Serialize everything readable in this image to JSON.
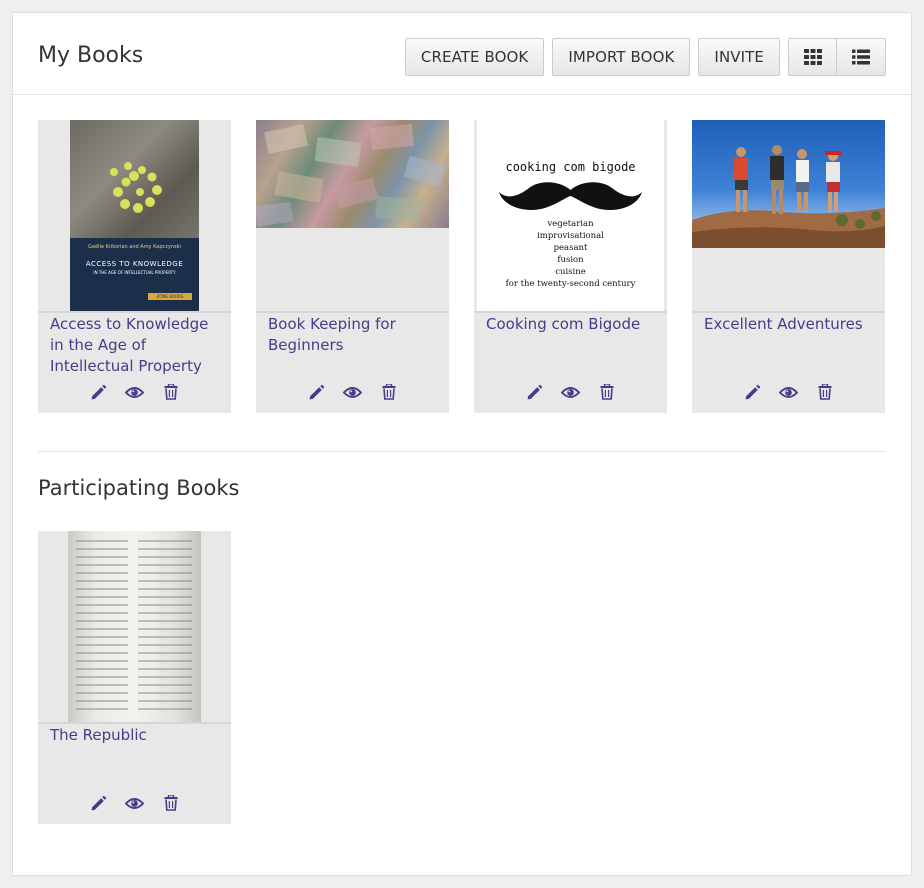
{
  "header": {
    "title": "My Books",
    "buttons": {
      "create": "CREATE BOOK",
      "import": "IMPORT BOOK",
      "invite": "INVITE"
    },
    "view_toggle": [
      "grid-view-icon",
      "list-view-icon"
    ]
  },
  "my_books": [
    {
      "title": "Access to Knowledge in the Age of Intellectual Property",
      "cover": "cover-access-to-knowledge"
    },
    {
      "title": "Book Keeping for Beginners",
      "cover": "cover-banknotes-photo"
    },
    {
      "title": "Cooking com Bigode",
      "cover": "cover-mustache"
    },
    {
      "title": "Excellent Adventures",
      "cover": "cover-hikers-photo"
    }
  ],
  "participating": {
    "title": "Participating Books",
    "books": [
      {
        "title": "The Republic",
        "cover": "cover-manuscript"
      }
    ]
  },
  "covers": {
    "access": {
      "authors": "Gaëlle Krikorian and Amy Kapczynski",
      "title": "ACCESS TO KNOWLEDGE",
      "subtitle": "IN THE AGE OF INTELLECTUAL PROPERTY",
      "publisher": "ZONE BOOKS"
    },
    "cooking": {
      "title": "cooking com bigode",
      "lines": [
        "vegetarian",
        "improvisational",
        "peasant",
        "fusion",
        "cuisine",
        "for the twenty-second century"
      ]
    }
  },
  "colors": {
    "accent": "#4a3a8c",
    "card_bg": "#e8e8e8",
    "page_bg": "#efefef"
  },
  "card_action_icons": [
    "pencil-icon",
    "eye-icon",
    "trash-icon"
  ]
}
